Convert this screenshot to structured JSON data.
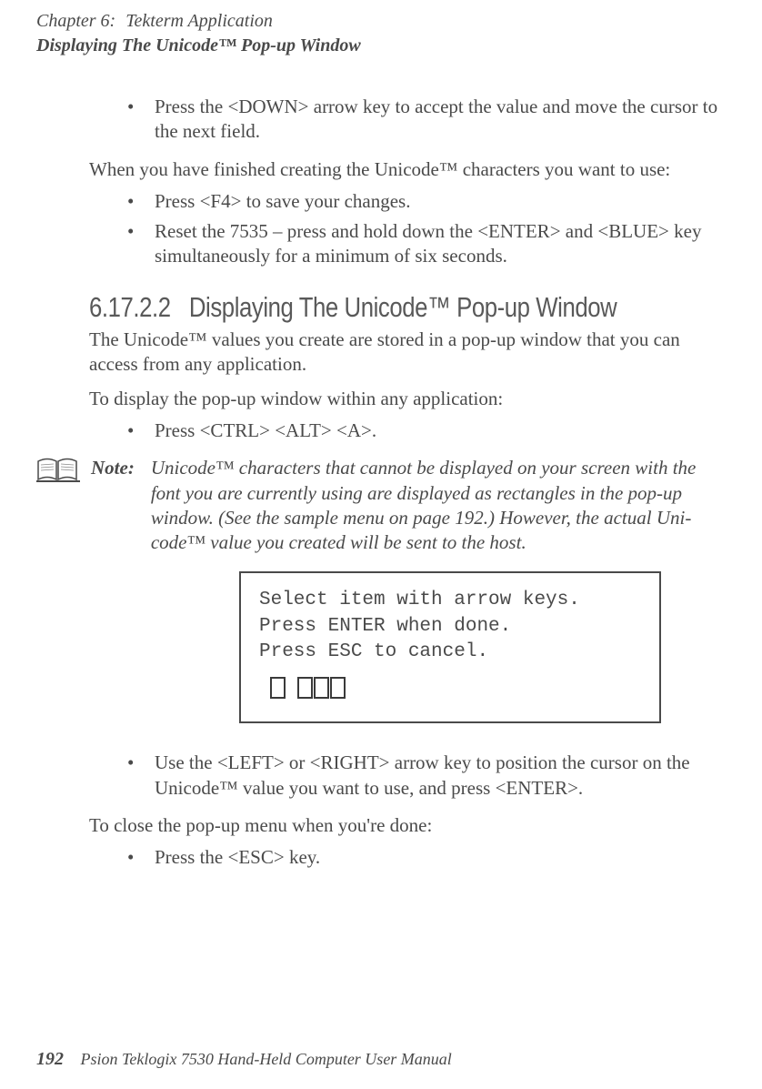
{
  "header": {
    "chapter_label": "Chapter 6:",
    "chapter_title": "Tekterm Application",
    "section_title": "Displaying The Unicode™ Pop-up Window"
  },
  "body": {
    "bullet1": "Press the <DOWN> arrow key to accept the value and move the cursor to the next field.",
    "para1": "When you have finished creating the Unicode™ characters you want to use:",
    "bullet2": "Press <F4> to save your changes.",
    "bullet3": "Reset the 7535 – press and hold down the <ENTER> and <BLUE> key simultaneously for a minimum of six seconds.",
    "heading_num": "6.17.2.2",
    "heading_text": "Displaying The Unicode™ Pop-up Window",
    "para2": "The Unicode™ values you create are stored in a pop-up window that you can access from any application.",
    "para3": "To display the pop-up window within any application:",
    "bullet4": "Press <CTRL> <ALT> <A>.",
    "note_label": "Note:",
    "note_text": "Unicode™ characters that cannot be displayed on your screen with the font you are currently using are displayed as rectangles in the pop-up window. (See the sample menu on page 192.) However, the actual Uni-code™ value you created will be sent to the host.",
    "popup_line1": "Select item with arrow keys.",
    "popup_line2": "Press ENTER when done.",
    "popup_line3": "Press ESC to cancel.",
    "bullet5": "Use the <LEFT> or <RIGHT> arrow key to position the cursor on the Unicode™ value you want to use, and press <ENTER>.",
    "para4": "To close the pop-up menu when you're done:",
    "bullet6": "Press the <ESC> key."
  },
  "footer": {
    "page_number": "192",
    "manual_title": "Psion Teklogix 7530 Hand-Held Computer User Manual"
  }
}
